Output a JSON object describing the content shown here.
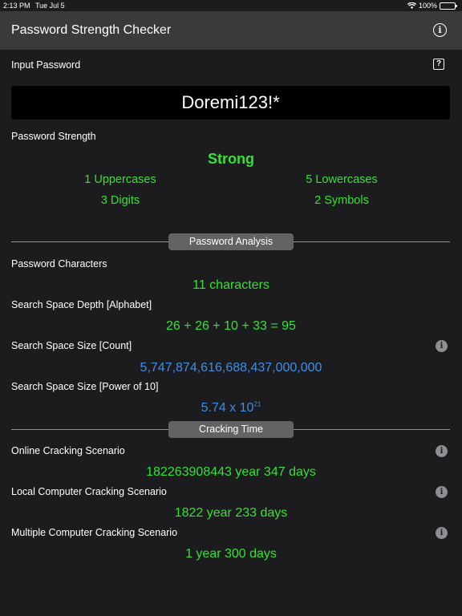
{
  "status_bar": {
    "time": "2:13 PM",
    "date": "Tue Jul 5",
    "battery": "100%"
  },
  "nav": {
    "title": "Password Strength Checker"
  },
  "input": {
    "label": "Input Password",
    "help": "?",
    "value": "Doremi123!*"
  },
  "strength": {
    "label": "Password Strength",
    "rating": "Strong",
    "uppercases": "1 Uppercases",
    "lowercases": "5 Lowercases",
    "digits": "3 Digits",
    "symbols": "2 Symbols"
  },
  "analysis": {
    "section_title": "Password Analysis",
    "characters_label": "Password Characters",
    "characters_value": "11 characters",
    "depth_label": "Search Space Depth [Alphabet]",
    "depth_value": "26 + 26 + 10 + 33 = 95",
    "size_count_label": "Search Space Size [Count]",
    "size_count_value": "5,747,874,616,688,437,000,000",
    "size_power_label": "Search Space Size [Power of 10]",
    "size_power_base": "5.74 x 10",
    "size_power_exp": "21"
  },
  "cracking": {
    "section_title": "Cracking Time",
    "online_label": "Online Cracking Scenario",
    "online_value": "182263908443 year 347 days",
    "local_label": "Local Computer Cracking Scenario",
    "local_value": "1822 year 233 days",
    "multi_label": "Multiple Computer Cracking Scenario",
    "multi_value": "1 year 300 days"
  },
  "colors": {
    "green": "#33e233",
    "blue": "#3d8ee8",
    "background": "#1c1c1e",
    "navbar": "#3a3a3c"
  },
  "icons": {
    "nav_info": "info-circle-icon",
    "help": "question-square-icon",
    "info": "info-filled-icon"
  }
}
